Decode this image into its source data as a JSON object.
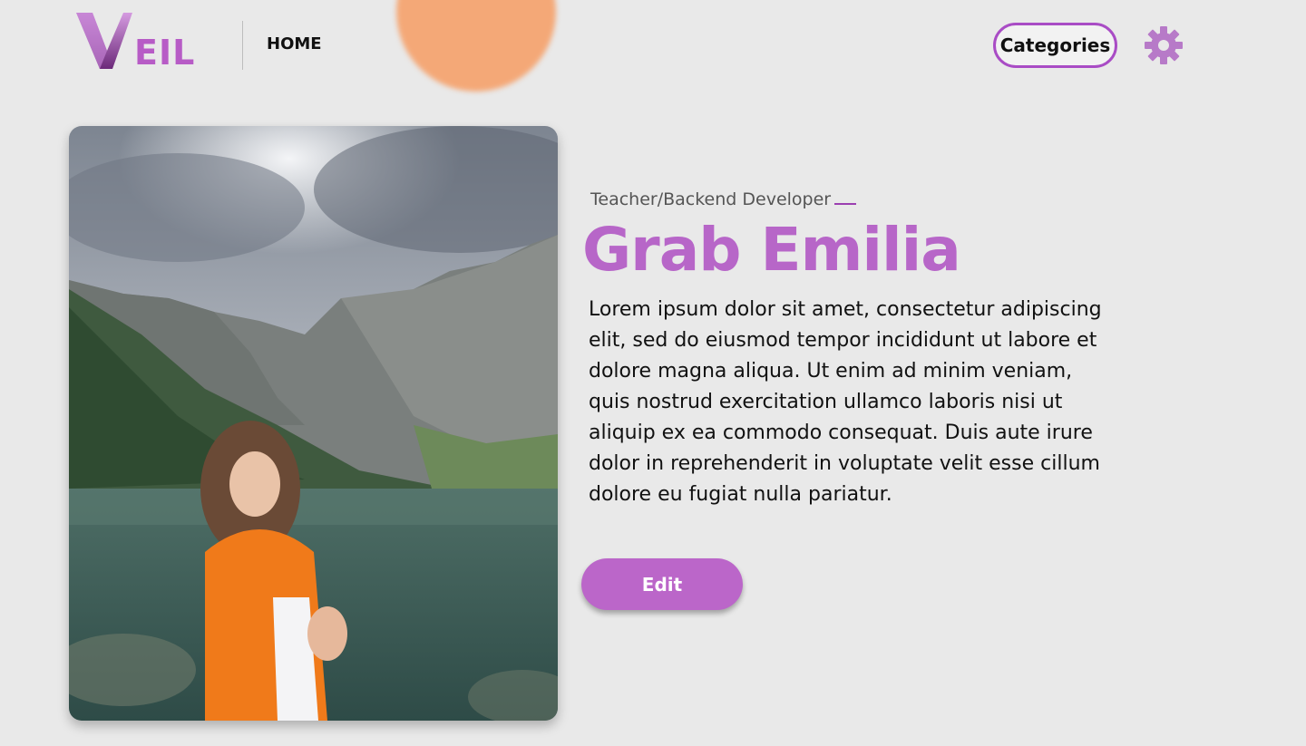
{
  "header": {
    "logo_text": "EIL",
    "nav_home": "HOME",
    "categories_label": "Categories",
    "settings_icon": "gear-icon"
  },
  "profile": {
    "photo_description": "profile-photo",
    "role": "Teacher/Backend Developer",
    "name": "Grab Emilia",
    "bio": " Lorem ipsum dolor sit amet, consectetur adipiscing elit, sed do eiusmod tempor incididunt ut labore et dolore magna aliqua. Ut enim ad minim veniam, quis nostrud exercitation ullamco laboris nisi ut aliquip ex ea commodo consequat. Duis aute irure dolor in reprehenderit in voluptate velit esse cillum dolore eu fugiat nulla pariatur.",
    "edit_label": "Edit"
  },
  "colors": {
    "accent": "#b766c8",
    "button": "#bb66c9",
    "border": "#a94cc5",
    "blob": "#f4a877",
    "background": "#e9e9e9"
  }
}
